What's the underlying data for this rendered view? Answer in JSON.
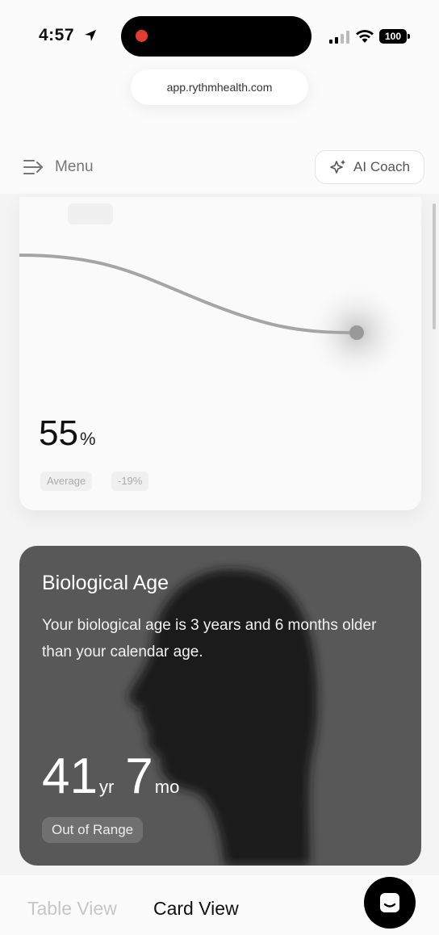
{
  "status_bar": {
    "time": "4:57",
    "battery": "100",
    "recording_color": "#e33b2f"
  },
  "browser": {
    "url": "app.rythmhealth.com"
  },
  "header": {
    "menu_label": "Menu",
    "menu_icon": "menu-arrow-icon",
    "coach_label": "AI Coach",
    "coach_icon": "sparkle-icon"
  },
  "metric_card": {
    "value": "55",
    "unit": "%",
    "chips": [
      "Average",
      "-19%"
    ]
  },
  "bio_card": {
    "title": "Biological Age",
    "description": "Your biological age is 3 years and 6 months older than your calendar age.",
    "years": "41",
    "years_unit": "yr",
    "months": "7",
    "months_unit": "mo",
    "status": "Out of Range",
    "background": "#585858"
  },
  "bottom_bar": {
    "table_view": "Table View",
    "card_view": "Card View",
    "active_tab": "Card View",
    "chat_icon": "chat-icon"
  }
}
